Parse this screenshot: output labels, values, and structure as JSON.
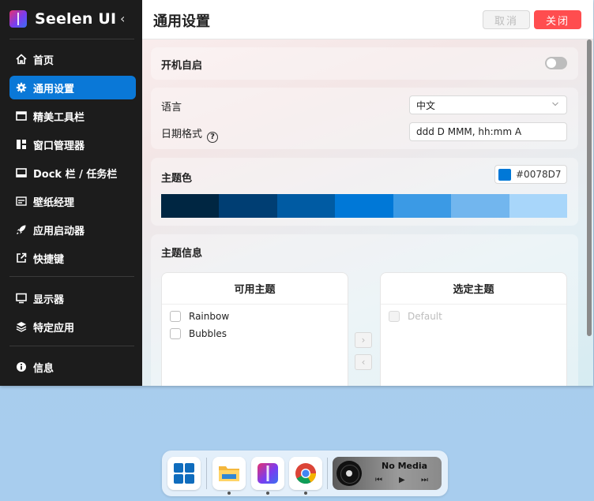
{
  "app": {
    "name": "Seelen UI",
    "collapse_glyph": "‹"
  },
  "sidebar": {
    "items": [
      {
        "label": "首页",
        "icon": "home-icon"
      },
      {
        "label": "通用设置",
        "icon": "gear-icon",
        "active": true
      },
      {
        "label": "精美工具栏",
        "icon": "toolbar-icon"
      },
      {
        "label": "窗口管理器",
        "icon": "window-manager-icon"
      },
      {
        "label": "Dock 栏 / 任务栏",
        "icon": "dock-icon"
      },
      {
        "label": "壁纸经理",
        "icon": "wallpaper-icon"
      },
      {
        "label": "应用启动器",
        "icon": "rocket-icon"
      },
      {
        "label": "快捷键",
        "icon": "shortcut-icon"
      },
      {
        "label": "显示器",
        "icon": "monitor-icon"
      },
      {
        "label": "特定应用",
        "icon": "layers-icon"
      },
      {
        "label": "信息",
        "icon": "info-icon"
      }
    ]
  },
  "header": {
    "title": "通用设置",
    "cancel_label": "取消",
    "close_label": "关闭"
  },
  "settings": {
    "autostart": {
      "label": "开机自启",
      "enabled": false
    },
    "language": {
      "label": "语言",
      "value": "中文"
    },
    "date_format": {
      "label": "日期格式",
      "help_glyph": "?",
      "value": "ddd D MMM, hh:mm A"
    },
    "theme_color": {
      "label": "主题色",
      "value": "#0078D7",
      "palette": [
        "#002642",
        "#003e73",
        "#005ba3",
        "#0078d7",
        "#3b9ae5",
        "#72b6ee",
        "#a8d6fa"
      ]
    },
    "theme_info": {
      "label": "主题信息",
      "available": {
        "title": "可用主题",
        "items": [
          "Rainbow",
          "Bubbles"
        ]
      },
      "selected": {
        "title": "选定主题",
        "items": [
          "Default"
        ]
      },
      "move_right_glyph": "›",
      "move_left_glyph": "‹"
    }
  },
  "dock": {
    "apps": [
      {
        "name": "start-menu-icon"
      },
      {
        "name": "file-explorer-icon",
        "running": true
      },
      {
        "name": "seelen-ui-icon",
        "running": true
      },
      {
        "name": "chrome-icon",
        "running": true
      }
    ],
    "media": {
      "title": "No Media",
      "prev": "⏮",
      "play": "▶",
      "next": "⏭"
    }
  }
}
